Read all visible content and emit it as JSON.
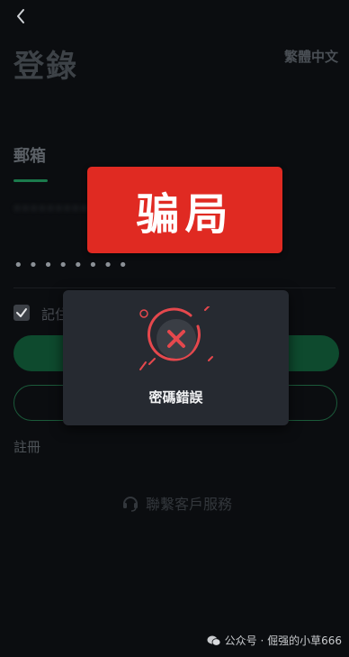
{
  "header": {
    "back_label": "back",
    "title": "登錄",
    "language": "繁體中文"
  },
  "tabs": [
    {
      "label": "郵箱",
      "active": true
    }
  ],
  "form": {
    "email_value": "••••••••••",
    "password_value": "••••••••",
    "remember_label": "記住",
    "remember_checked": true,
    "login_button_label": "",
    "register_button_label": ""
  },
  "register_link": "註冊",
  "contact": {
    "label": "聯繫客戶服務",
    "icon": "headset-icon"
  },
  "overlay": {
    "scam_label": "骗局"
  },
  "dialog": {
    "icon": "error-x-icon",
    "message": "密碼錯誤"
  },
  "watermark": "公众号 · 倔强的小草666",
  "colors": {
    "accent": "#1b7a4c",
    "error": "#e5484d",
    "banner": "#e02a22"
  }
}
